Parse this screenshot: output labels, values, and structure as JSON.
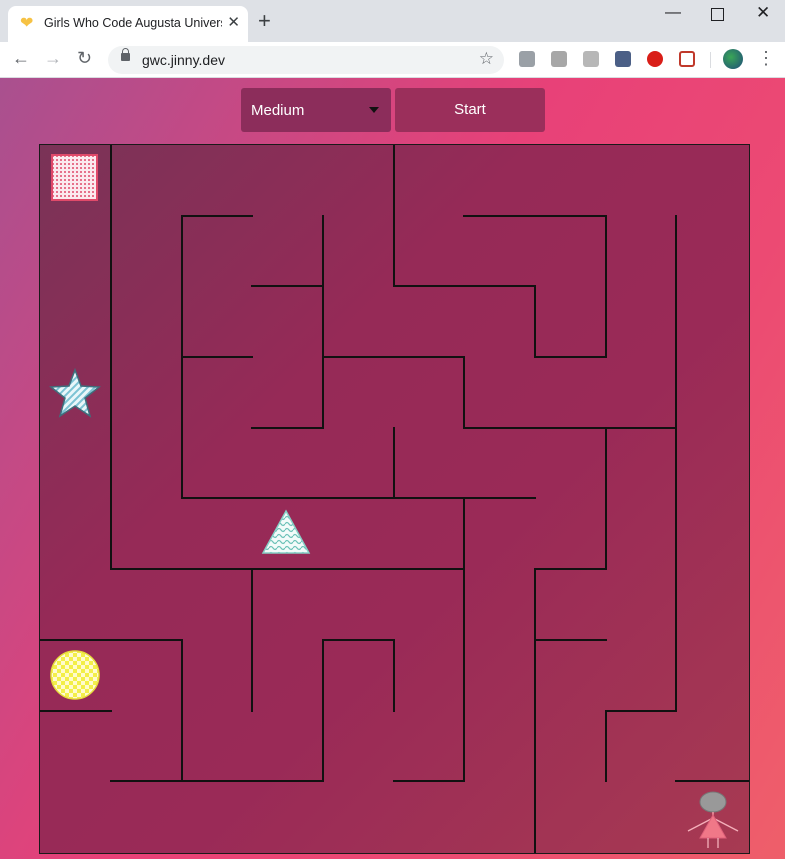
{
  "browser": {
    "tab_title": "Girls Who Code Augusta University",
    "new_tab_label": "+",
    "url": "gwc.jinny.dev"
  },
  "controls": {
    "difficulty_selected": "Medium",
    "start_label": "Start"
  },
  "maze": {
    "items": [
      {
        "name": "square-tile",
        "icon": "checkered-square-icon",
        "color": "#e04a6a"
      },
      {
        "name": "star-tile",
        "icon": "striped-star-icon",
        "color": "#b8e6ec"
      },
      {
        "name": "triangle-tile",
        "icon": "wavy-triangle-icon",
        "color": "#a8ddd8"
      },
      {
        "name": "circle-tile",
        "icon": "checkered-circle-icon",
        "color": "#f3ef4a"
      },
      {
        "name": "player",
        "icon": "girl-figure-icon",
        "color": "#f08090"
      }
    ]
  }
}
